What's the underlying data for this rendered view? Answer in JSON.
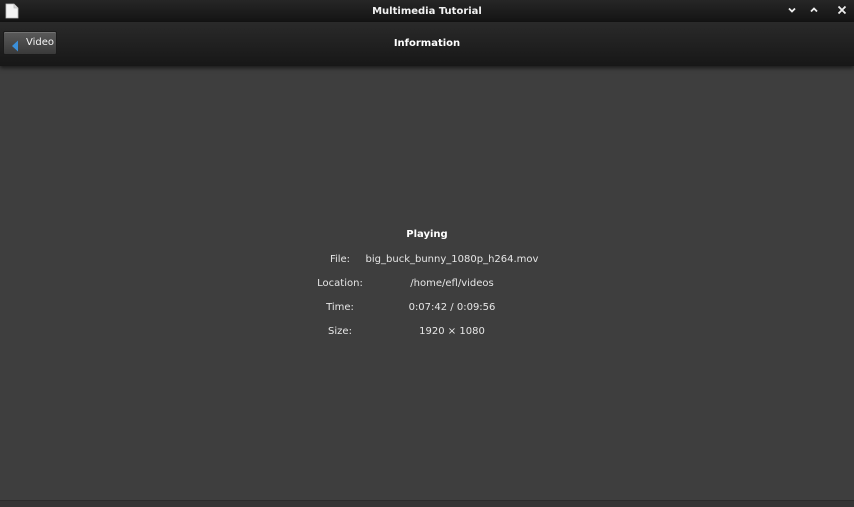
{
  "window": {
    "title": "Multimedia Tutorial",
    "icons": [
      "document-icon",
      "chevron-down-icon",
      "chevron-up-icon",
      "close-icon"
    ]
  },
  "header": {
    "back_label": "Video",
    "title": "Information"
  },
  "info": {
    "heading": "Playing",
    "rows": [
      {
        "label": "File:",
        "value": "big_buck_bunny_1080p_h264.mov"
      },
      {
        "label": "Location:",
        "value": "/home/efl/videos"
      },
      {
        "label": "Time:",
        "value": "0:07:42 / 0:09:56"
      },
      {
        "label": "Size:",
        "value": "1920 × 1080"
      }
    ]
  },
  "colors": {
    "background": "#3e3e3e",
    "header": "#1f1f1f",
    "accent": "#3b8fd9"
  }
}
